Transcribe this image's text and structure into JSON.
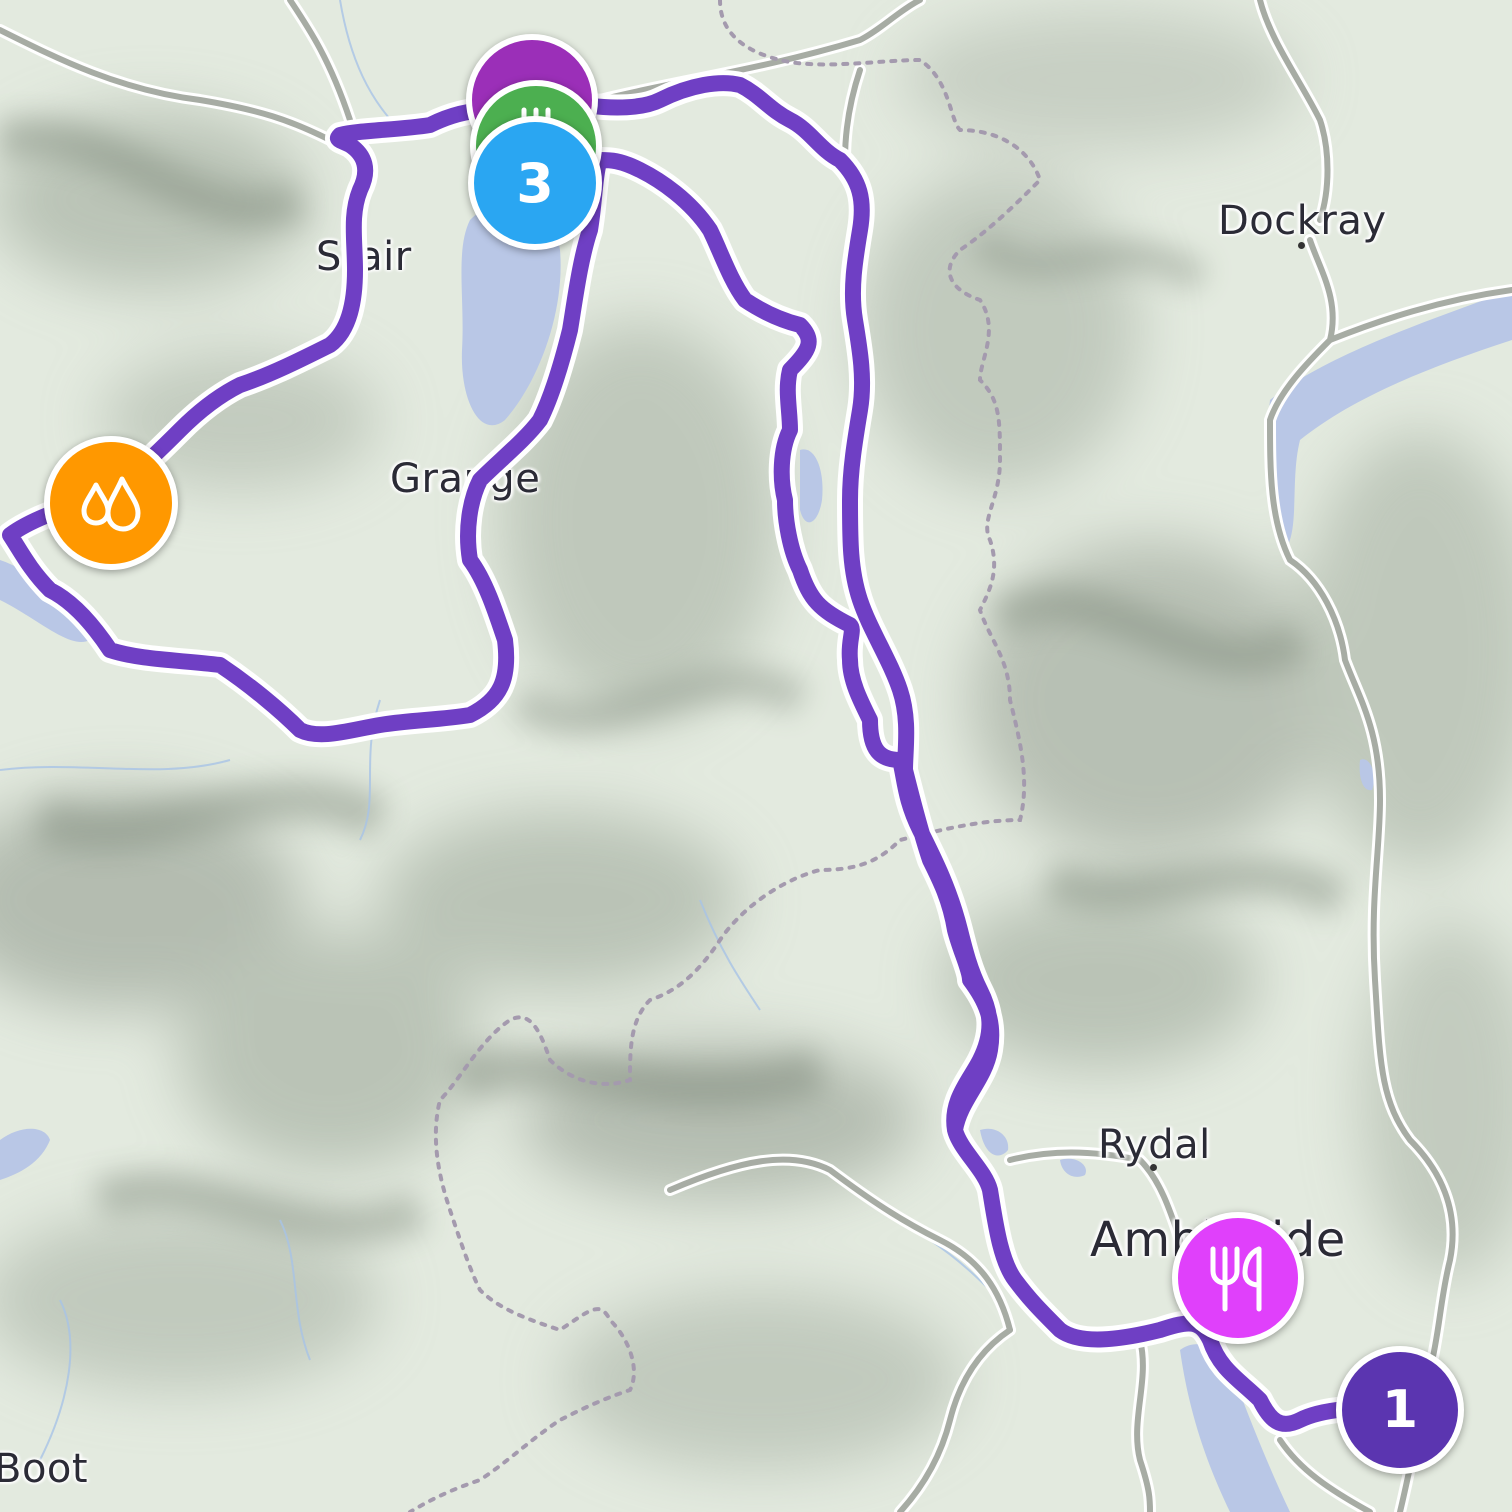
{
  "map": {
    "places": {
      "dockray": "Dockray",
      "stair": "Stair",
      "grange": "Grange",
      "rydal": "Rydal",
      "ambleside": "Ambleside",
      "boot": "Boot"
    },
    "route_color": "#6f3fc4",
    "markers": {
      "start": {
        "label": "1",
        "color": "#5b35b0"
      },
      "stop3": {
        "label": "3",
        "color": "#2aa6f2"
      },
      "stacked_top": {
        "icon": "restaurant-icon",
        "color": "#9b2fb8"
      },
      "stacked_mid": {
        "icon": "restaurant-icon",
        "color": "#4caf50"
      },
      "water": {
        "icon": "water-drops-icon",
        "color": "#ff9800"
      },
      "restaurant": {
        "icon": "fork-knife-icon",
        "color": "#e040fb"
      }
    }
  }
}
